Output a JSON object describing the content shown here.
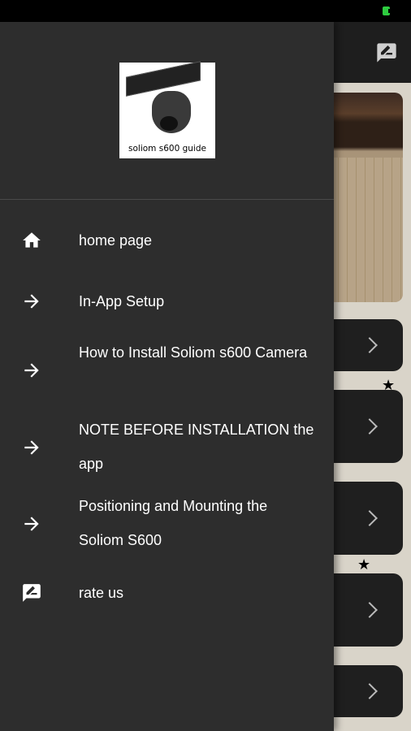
{
  "drawer": {
    "logo_caption": "soliom s600 guide",
    "items": [
      {
        "icon": "home-icon",
        "label": "home page"
      },
      {
        "icon": "arrow-right-icon",
        "label": "In-App Setup"
      },
      {
        "icon": "arrow-right-icon",
        "label": "How to Install Soliom s600 Camera"
      },
      {
        "icon": "arrow-right-icon",
        "label": "NOTE BEFORE INSTALLATION the app"
      },
      {
        "icon": "arrow-right-icon",
        "label": "Positioning and Mounting the Soliom S600"
      },
      {
        "icon": "rate-review-icon",
        "label": "rate us"
      }
    ]
  },
  "colors": {
    "drawer_bg": "#2d2d2d",
    "toolbar_bg": "#1e1e1e",
    "status_bar": "#000000",
    "battery": "#2ecc40"
  }
}
